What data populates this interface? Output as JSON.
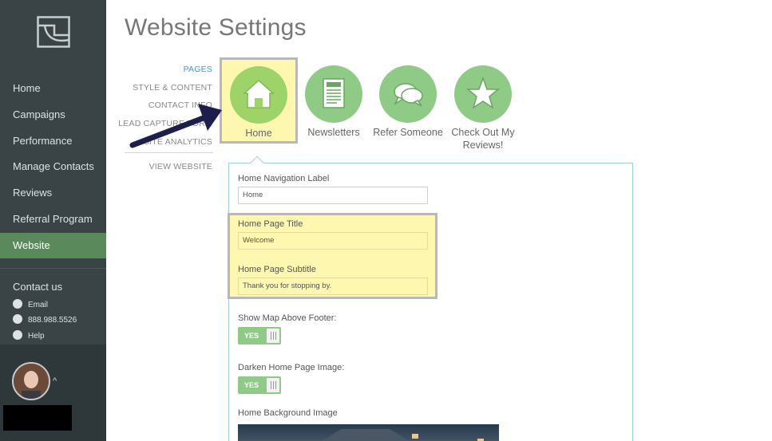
{
  "sidebar": {
    "items": [
      {
        "label": "Home"
      },
      {
        "label": "Campaigns"
      },
      {
        "label": "Performance"
      },
      {
        "label": "Manage Contacts"
      },
      {
        "label": "Reviews"
      },
      {
        "label": "Referral Program"
      },
      {
        "label": "Website",
        "active": true
      }
    ],
    "contact_title": "Contact us",
    "contact": [
      {
        "icon": "email-icon",
        "label": "Email"
      },
      {
        "icon": "phone-icon",
        "label": "888.988.5526"
      },
      {
        "icon": "help-icon",
        "label": "Help"
      }
    ]
  },
  "page_title": "Website Settings",
  "subnav": {
    "items": [
      "PAGES",
      "STYLE & CONTENT",
      "CONTACT INFO",
      "LEAD CAPTURE FORM",
      "SITE ANALYTICS"
    ],
    "view_website": "VIEW WEBSITE"
  },
  "page_tiles": [
    {
      "label": "Home",
      "icon": "house-icon",
      "active": true
    },
    {
      "label": "Newsletters",
      "icon": "newsletter-icon"
    },
    {
      "label": "Refer Someone",
      "icon": "speech-bubbles-icon"
    },
    {
      "label": "Check Out My Reviews!",
      "icon": "star-icon"
    }
  ],
  "form": {
    "nav_label": {
      "label": "Home Navigation Label",
      "value": "Home"
    },
    "page_title": {
      "label": "Home Page Title",
      "value": "Welcome"
    },
    "page_subtitle": {
      "label": "Home Page Subtitle",
      "value": "Thank you for stopping by."
    },
    "show_map": {
      "label": "Show Map Above Footer:",
      "toggle": "YES"
    },
    "darken_image": {
      "label": "Darken Home Page Image:",
      "toggle": "YES"
    },
    "bg_image": {
      "label": "Home Background Image"
    }
  },
  "colors": {
    "sidebar_bg": "#3a4446",
    "sidebar_active": "#5a8a5c",
    "accent_green": "#8fca86",
    "link_blue": "#3a9ad9",
    "highlight_yellow": "#fdf7b0",
    "arrow": "#1e1e4a"
  }
}
